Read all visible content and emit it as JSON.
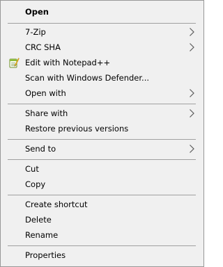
{
  "menu": {
    "open": "Open",
    "seven_zip": "7-Zip",
    "crc_sha": "CRC SHA",
    "edit_notepad": "Edit with Notepad++",
    "scan_defender": "Scan with Windows Defender...",
    "open_with": "Open with",
    "share_with": "Share with",
    "restore_versions": "Restore previous versions",
    "send_to": "Send to",
    "cut": "Cut",
    "copy": "Copy",
    "create_shortcut": "Create shortcut",
    "delete": "Delete",
    "rename": "Rename",
    "properties": "Properties"
  },
  "icons": {
    "submenu_arrow": "chevron-right-icon",
    "notepad": "notepad-plus-plus-icon"
  },
  "colors": {
    "menu_background": "#f0f0f0",
    "border": "#979797",
    "separator": "#a0a0a0",
    "text": "#000000"
  }
}
